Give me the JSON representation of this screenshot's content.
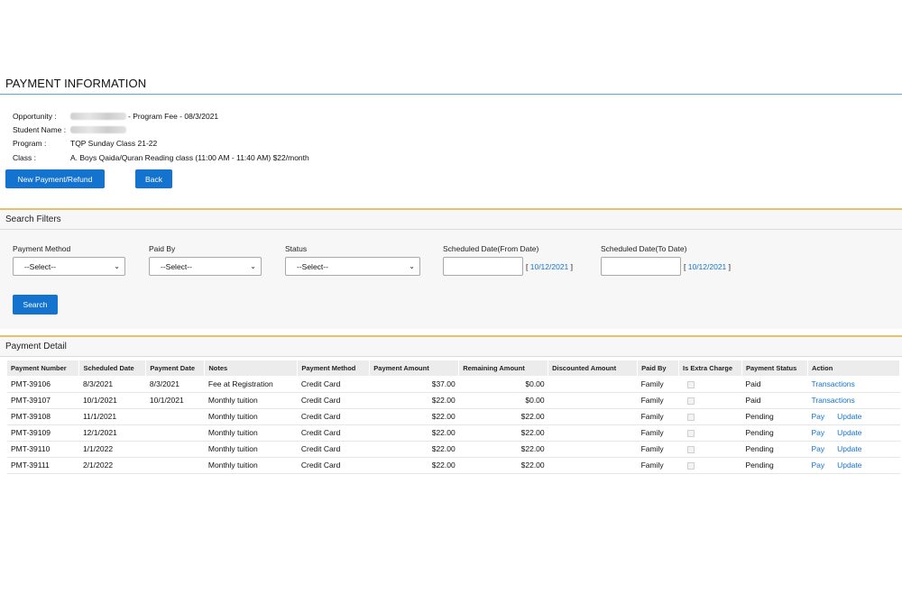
{
  "page": {
    "title": "PAYMENT INFORMATION"
  },
  "info": {
    "opportunity_label": "Opportunity :",
    "opportunity_value": "- Program Fee - 08/3/2021",
    "student_label": "Student Name :",
    "program_label": "Program :",
    "program_value": "TQP Sunday Class 21-22",
    "class_label": "Class :",
    "class_value": "A. Boys Qaida/Quran Reading class (11:00 AM - 11:40 AM) $22/month"
  },
  "buttons": {
    "new_payment": "New Payment/Refund",
    "back": "Back",
    "search": "Search"
  },
  "filters": {
    "title": "Search Filters",
    "payment_method_label": "Payment Method",
    "payment_method_value": "--Select--",
    "paid_by_label": "Paid By",
    "paid_by_value": "--Select--",
    "status_label": "Status",
    "status_value": "--Select--",
    "from_label": "Scheduled Date(From Date)",
    "from_link": "10/12/2021",
    "to_label": "Scheduled Date(To Date)",
    "to_link": "10/12/2021"
  },
  "detail": {
    "title": "Payment Detail",
    "columns": [
      "Payment Number",
      "Scheduled Date",
      "Payment Date",
      "Notes",
      "Payment Method",
      "Payment Amount",
      "Remaining Amount",
      "Discounted Amount",
      "Paid By",
      "Is Extra Charge",
      "Payment Status",
      "Action"
    ],
    "rows": [
      {
        "number": "PMT-39106",
        "scheduled": "8/3/2021",
        "paid_on": "8/3/2021",
        "notes": "Fee at Registration",
        "method": "Credit Card",
        "amount": "$37.00",
        "remaining": "$0.00",
        "discount": "",
        "paid_by": "Family",
        "status": "Paid",
        "action1": "Transactions",
        "action2": ""
      },
      {
        "number": "PMT-39107",
        "scheduled": "10/1/2021",
        "paid_on": "10/1/2021",
        "notes": "Monthly tuition",
        "method": "Credit Card",
        "amount": "$22.00",
        "remaining": "$0.00",
        "discount": "",
        "paid_by": "Family",
        "status": "Paid",
        "action1": "Transactions",
        "action2": ""
      },
      {
        "number": "PMT-39108",
        "scheduled": "11/1/2021",
        "paid_on": "",
        "notes": "Monthly tuition",
        "method": "Credit Card",
        "amount": "$22.00",
        "remaining": "$22.00",
        "discount": "",
        "paid_by": "Family",
        "status": "Pending",
        "action1": "Pay",
        "action2": "Update"
      },
      {
        "number": "PMT-39109",
        "scheduled": "12/1/2021",
        "paid_on": "",
        "notes": "Monthly tuition",
        "method": "Credit Card",
        "amount": "$22.00",
        "remaining": "$22.00",
        "discount": "",
        "paid_by": "Family",
        "status": "Pending",
        "action1": "Pay",
        "action2": "Update"
      },
      {
        "number": "PMT-39110",
        "scheduled": "1/1/2022",
        "paid_on": "",
        "notes": "Monthly tuition",
        "method": "Credit Card",
        "amount": "$22.00",
        "remaining": "$22.00",
        "discount": "",
        "paid_by": "Family",
        "status": "Pending",
        "action1": "Pay",
        "action2": "Update"
      },
      {
        "number": "PMT-39111",
        "scheduled": "2/1/2022",
        "paid_on": "",
        "notes": "Monthly tuition",
        "method": "Credit Card",
        "amount": "$22.00",
        "remaining": "$22.00",
        "discount": "",
        "paid_by": "Family",
        "status": "Pending",
        "action1": "Pay",
        "action2": "Update"
      }
    ]
  },
  "colors": {
    "accent": "#1473cf",
    "panel_border": "#e8c26a",
    "title_rule": "#5aa7e0"
  }
}
